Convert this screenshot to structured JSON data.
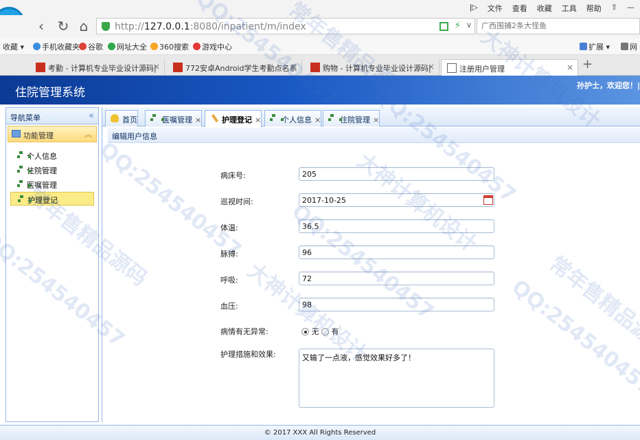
{
  "browser": {
    "top_menu": [
      "|▷",
      "文件",
      "查看",
      "收藏",
      "工具",
      "帮助",
      "⇧",
      "—"
    ],
    "url_prefix": "http://",
    "url_host": "127.0.0.1",
    "url_rest": ":8080/inpatient/m/index",
    "search_text": "广西围捕2条大怪鱼",
    "bookmarks": [
      "收藏 ▾",
      "手机收藏夹",
      "谷歌",
      "网址大全",
      "360搜索",
      "游戏中心",
      "扩展 ▾",
      "网"
    ],
    "tabs": [
      {
        "label": "考勤 - 计算机专业毕业设计源码|"
      },
      {
        "label": "772安卓Android学生考勤点名系"
      },
      {
        "label": "购物 - 计算机专业毕业设计源码|"
      },
      {
        "label": "注册用户管理"
      }
    ],
    "new_tab": "+"
  },
  "app": {
    "title": "住院管理系统",
    "welcome": "孙护士，欢迎您！|"
  },
  "sidebar": {
    "heading": "导航菜单",
    "collapse_glyph": "«",
    "section": "功能管理",
    "section_glyph": "︽",
    "items": [
      {
        "label": "个人信息"
      },
      {
        "label": "住院管理"
      },
      {
        "label": "医嘱管理"
      },
      {
        "label": "护理登记"
      }
    ]
  },
  "panel_tabs": [
    {
      "label": "首页",
      "icon": "bulb-icon"
    },
    {
      "label": "医嘱管理",
      "icon": "tree-icon"
    },
    {
      "label": "护理登记",
      "icon": "pen-icon"
    },
    {
      "label": "个人信息",
      "icon": "tree-icon"
    },
    {
      "label": "住院管理",
      "icon": "tree-icon"
    }
  ],
  "close_glyph": "×",
  "form": {
    "title": "编辑用户信息",
    "bed_label": "病床号:",
    "bed_value": "205",
    "time_label": "巡视时间:",
    "time_value": "2017-10-25",
    "temp_label": "体温:",
    "temp_value": "36.5",
    "pulse_label": "脉搏:",
    "pulse_value": "96",
    "breath_label": "呼吸:",
    "breath_value": "72",
    "bp_label": "血压:",
    "bp_value": "98",
    "abnormal_label": "病情有无异常:",
    "abnormal_options": [
      "无",
      "有"
    ],
    "abnormal_selected": "无",
    "measures_label": "护理措施和效果:",
    "measures_value": "又输了一点液，感觉效果好多了！"
  },
  "footer": "© 2017 XXX All Rights Reserved",
  "watermarks": [
    "QQ:254540457",
    "大神计算机设计",
    "常年售精品源码"
  ]
}
